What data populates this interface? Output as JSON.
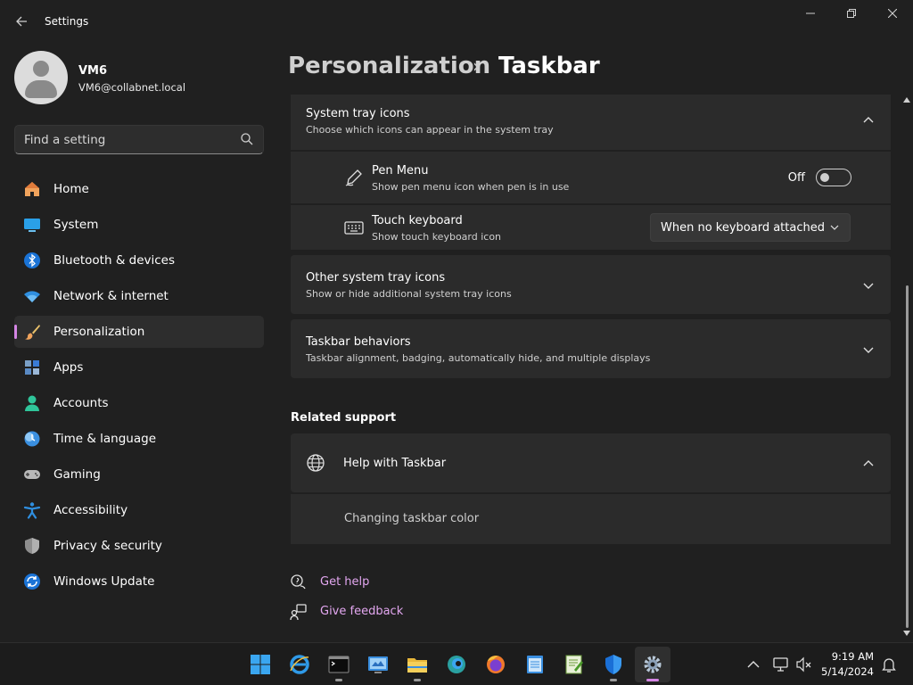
{
  "window": {
    "title": "Settings",
    "controls": {
      "minimize": "—",
      "restore": "❐",
      "close": "✕"
    }
  },
  "profile": {
    "name": "VM6",
    "email": "VM6@collabnet.local"
  },
  "search": {
    "placeholder": "Find a setting",
    "value": ""
  },
  "nav": {
    "items": [
      {
        "label": "Home",
        "icon": "home-icon"
      },
      {
        "label": "System",
        "icon": "system-icon"
      },
      {
        "label": "Bluetooth & devices",
        "icon": "bluetooth-icon"
      },
      {
        "label": "Network & internet",
        "icon": "wifi-icon"
      },
      {
        "label": "Personalization",
        "icon": "brush-icon",
        "selected": true
      },
      {
        "label": "Apps",
        "icon": "apps-icon"
      },
      {
        "label": "Accounts",
        "icon": "accounts-icon"
      },
      {
        "label": "Time & language",
        "icon": "clock-icon"
      },
      {
        "label": "Gaming",
        "icon": "gamepad-icon"
      },
      {
        "label": "Accessibility",
        "icon": "accessibility-icon"
      },
      {
        "label": "Privacy & security",
        "icon": "shield-icon"
      },
      {
        "label": "Windows Update",
        "icon": "update-icon"
      }
    ]
  },
  "header": {
    "parent": "Personalization",
    "separator": "›",
    "current": "Taskbar"
  },
  "system_tray": {
    "title": "System tray icons",
    "description": "Choose which icons can appear in the system tray",
    "pen_menu": {
      "title": "Pen Menu",
      "description": "Show pen menu icon when pen is in use",
      "state_label": "Off",
      "enabled": false
    },
    "touch_keyboard": {
      "title": "Touch keyboard",
      "description": "Show touch keyboard icon",
      "selected": "When no keyboard attached"
    }
  },
  "other_tray": {
    "title": "Other system tray icons",
    "description": "Show or hide additional system tray icons"
  },
  "behaviors": {
    "title": "Taskbar behaviors",
    "description": "Taskbar alignment, badging, automatically hide, and multiple displays"
  },
  "related_support": {
    "title": "Related support",
    "help_title": "Help with Taskbar",
    "help_link": "Changing taskbar color"
  },
  "footer_links": {
    "get_help": "Get help",
    "give_feedback": "Give feedback"
  },
  "taskbar": {
    "apps": [
      "start-icon",
      "internet-explorer-icon",
      "terminal-icon",
      "control-panel-icon",
      "file-explorer-icon",
      "edge-icon",
      "firefox-icon",
      "notepad-icon",
      "editor-icon",
      "defender-icon",
      "settings-icon"
    ],
    "time": "9:19 AM",
    "date": "5/14/2024"
  },
  "colors": {
    "accent": "#d485e4",
    "link": "#e3a7f0",
    "background": "#202020",
    "card": "#2b2b2b"
  }
}
